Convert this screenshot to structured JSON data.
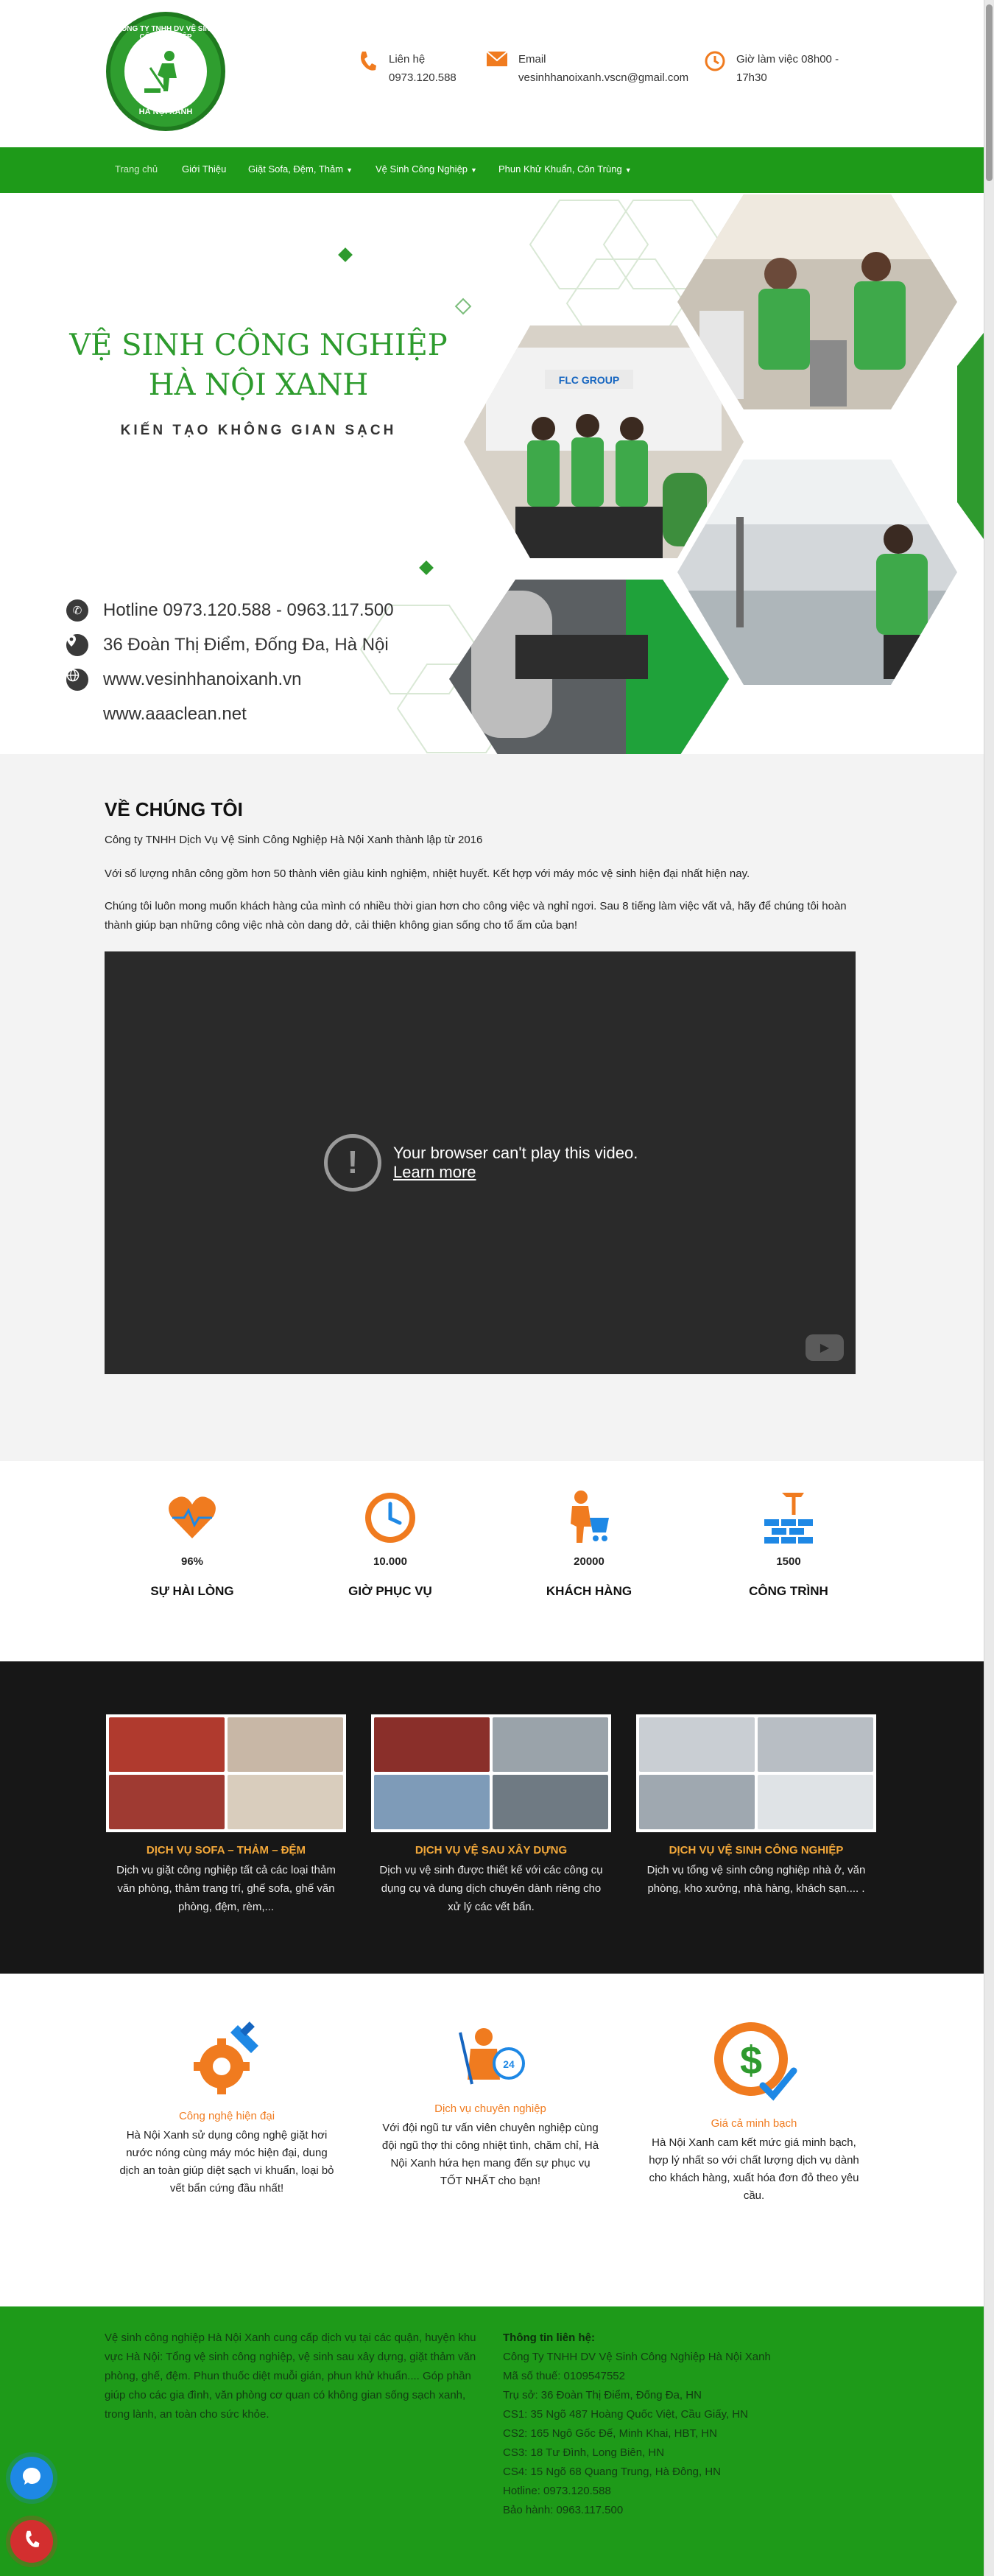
{
  "header": {
    "logo_ring_top": "CÔNG TY TNHH DV VỆ SINH CÔNG NGHIỆP",
    "logo_ring_bottom": "HÀ NỘI XANH",
    "contacts": [
      {
        "icon": "phone-icon",
        "label": "Liên hệ",
        "value": "0973.120.588"
      },
      {
        "icon": "mail-icon",
        "label": "Email",
        "value": "vesinhhanoixanh.vscn@gmail.com"
      },
      {
        "icon": "clock-icon",
        "label": "Giờ làm việc 08h00 -",
        "value": "17h30"
      }
    ]
  },
  "nav": {
    "items": [
      {
        "label": "Trang chủ",
        "dropdown": false
      },
      {
        "label": "Giới Thiệu",
        "dropdown": false
      },
      {
        "label": "Giặt Sofa, Đệm, Thảm",
        "dropdown": true
      },
      {
        "label": "Vệ Sinh Công Nghiệp",
        "dropdown": true
      },
      {
        "label": "Phun Khử Khuẩn, Côn Trùng",
        "dropdown": true
      }
    ]
  },
  "hero": {
    "title_line1": "VỆ SINH CÔNG NGHIỆP",
    "title_line2": "HÀ NỘI XANH",
    "tagline": "KIẾN TẠO KHÔNG GIAN SẠCH",
    "photo_sign": "FLC GROUP",
    "lines": [
      {
        "icon": "phone-icon",
        "text": "Hotline 0973.120.588 - 0963.117.500"
      },
      {
        "icon": "location-pin-icon",
        "text": "36 Đoàn Thị Điểm, Đống Đa, Hà Nội"
      },
      {
        "icon": "globe-icon",
        "text": "www.vesinhhanoixanh.vn"
      },
      {
        "icon": "",
        "text": "www.aaaclean.net"
      }
    ]
  },
  "about": {
    "heading": "VỀ CHÚNG TÔI",
    "p1": "Công ty TNHH Dịch Vụ Vệ Sinh Công Nghiệp Hà Nội Xanh thành lập từ 2016",
    "p2": "Với số lượng nhân công gồm hơn 50 thành viên giàu kinh nghiệm, nhiệt huyết. Kết hợp với máy móc vệ sinh hiện đại nhất hiện nay.",
    "p3": "Chúng tôi luôn mong muốn khách hàng của mình có nhiều thời gian hơn cho công việc và nghỉ ngơi. Sau 8 tiếng làm việc vất vả, hãy để chúng tôi hoàn thành giúp bạn những công việc nhà còn dang dở, cải thiện không gian sống cho tổ ấm của bạn!",
    "video": {
      "message": "Your browser can't play this video.",
      "link": "Learn more"
    }
  },
  "stats": [
    {
      "icon": "heart-pulse-icon",
      "value": "96%",
      "label": "SỰ HÀI LÒNG"
    },
    {
      "icon": "clock-icon",
      "value": "10.000",
      "label": "GIỜ PHỤC VỤ"
    },
    {
      "icon": "shopping-cart-person-icon",
      "value": "20000",
      "label": "KHÁCH HÀNG"
    },
    {
      "icon": "brick-wall-icon",
      "value": "1500",
      "label": "CÔNG TRÌNH"
    }
  ],
  "services": [
    {
      "title": "DỊCH VỤ SOFA – THẢM – ĐỆM",
      "desc": "Dịch vụ giặt công nghiệp tất cả các loại thảm văn phòng, thảm trang trí, ghế sofa, ghế văn phòng, đệm, rèm,..."
    },
    {
      "title": "DỊCH VỤ VỆ SAU XÂY DỰNG",
      "desc": "Dịch vụ vệ sinh được thiết kế với các công cụ dụng cụ và dung dịch chuyên dành riêng cho xử lý các vết bẩn."
    },
    {
      "title": "DỊCH VỤ VỆ SINH CÔNG NGHIỆP",
      "desc": "Dịch vụ tổng vệ sinh công nghiệp nhà ở, văn phòng, kho xưởng, nhà hàng, khách sạn.... ."
    }
  ],
  "features": [
    {
      "icon": "gear-brush-icon",
      "title": "Công nghệ hiện đại",
      "desc": "Hà Nội Xanh sử dụng công nghệ giặt hơi nước nóng cùng máy móc hiện đại, dung dịch an toàn giúp diệt sạch vi khuẩn, loại bỏ vết bẩn cứng đầu nhất!"
    },
    {
      "icon": "cleaner-24h-icon",
      "title": "Dịch vụ chuyên nghiệp",
      "desc": "Với đội ngũ tư vấn viên chuyên nghiệp cùng đội ngũ thợ thi công nhiệt tình, chăm chỉ, Hà Nội Xanh hứa hẹn mang đến sự phục vụ TỐT NHẤT cho bạn!"
    },
    {
      "icon": "dollar-check-icon",
      "title": "Giá cả minh bạch",
      "desc": "Hà Nội Xanh cam kết mức giá minh bạch, hợp lý nhất so với chất lượng dịch vụ dành cho khách hàng, xuất hóa đơn đỏ theo yêu cầu."
    }
  ],
  "footer": {
    "about": "Vệ sinh công nghiệp Hà Nội Xanh cung cấp dịch vụ tại các quận, huyện khu vực Hà Nội: Tổng vệ sinh công nghiệp, vệ sinh sau xây dựng, giặt thảm văn phòng, ghế, đệm. Phun thuốc diệt muỗi gián, phun khử khuẩn.... Góp phần giúp cho các gia đình, văn phòng cơ quan có không gian sống sạch xanh, trong lành, an toàn cho sức khỏe.",
    "contact_heading": "Thông tin liên hệ:",
    "contact_lines": [
      "Công Ty TNHH DV Vệ Sinh Công Nghiệp Hà Nội Xanh",
      "Mã số thuế: 0109547552",
      "Trụ sở: 36 Đoàn Thị Điểm, Đống Đa, HN",
      "CS1: 35 Ngõ 487 Hoàng Quốc Việt, Cầu Giấy, HN",
      "CS2: 165 Ngô Gốc Đế, Minh Khai, HBT, HN",
      "CS3: 18 Tư Đình, Long Biên, HN",
      "CS4: 15 Ngõ 68 Quang Trung, Hà Đông, HN",
      "Hotline: 0973.120.588",
      "Bảo hành: 0963.117.500"
    ]
  },
  "floating": {
    "chat_icon": "chat-bubble-icon",
    "call_icon": "phone-call-icon",
    "chat_color": "#1e88e5",
    "call_color": "#d32f2f"
  },
  "colors": {
    "brand_green": "#1e9a19",
    "accent_orange": "#f07b1f",
    "service_title": "#f3a83a"
  }
}
